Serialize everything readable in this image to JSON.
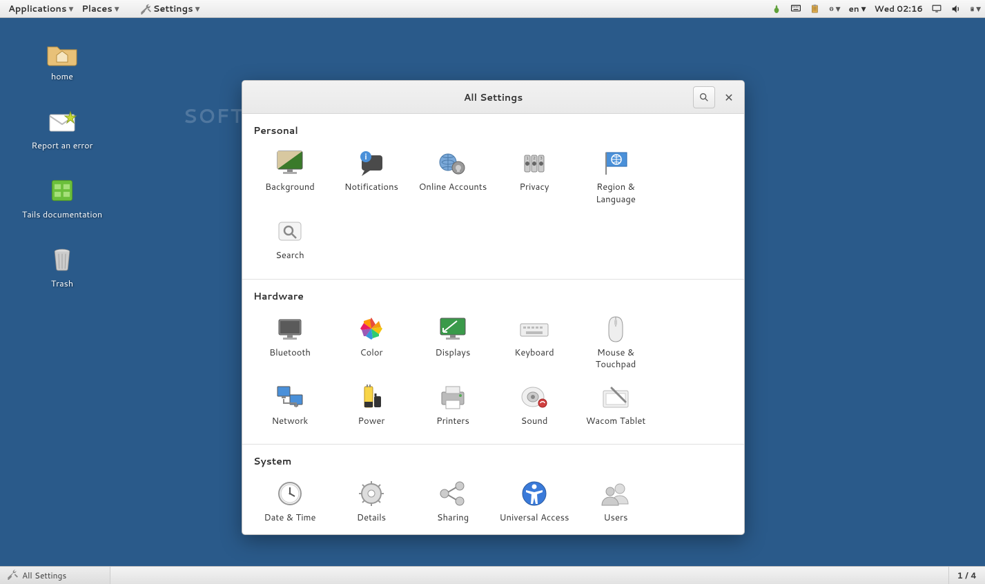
{
  "top_panel": {
    "menus": [
      "Applications",
      "Places",
      "Settings"
    ],
    "lang": "en",
    "clock": "Wed 02:16"
  },
  "desktop_icons": [
    {
      "id": "home",
      "label": "home"
    },
    {
      "id": "report",
      "label": "Report an error"
    },
    {
      "id": "docs",
      "label": "Tails documentation"
    },
    {
      "id": "trash",
      "label": "Trash"
    }
  ],
  "settings_window": {
    "title": "All Settings",
    "sections": [
      {
        "title": "Personal",
        "items": [
          {
            "id": "background",
            "label": "Background"
          },
          {
            "id": "notifications",
            "label": "Notifications"
          },
          {
            "id": "online-accounts",
            "label": "Online Accounts"
          },
          {
            "id": "privacy",
            "label": "Privacy"
          },
          {
            "id": "region",
            "label": "Region & Language"
          },
          {
            "id": "search",
            "label": "Search"
          }
        ]
      },
      {
        "title": "Hardware",
        "items": [
          {
            "id": "bluetooth",
            "label": "Bluetooth"
          },
          {
            "id": "color",
            "label": "Color"
          },
          {
            "id": "displays",
            "label": "Displays"
          },
          {
            "id": "keyboard",
            "label": "Keyboard"
          },
          {
            "id": "mouse",
            "label": "Mouse & Touchpad"
          },
          {
            "id": "network",
            "label": "Network"
          },
          {
            "id": "power",
            "label": "Power"
          },
          {
            "id": "printers",
            "label": "Printers"
          },
          {
            "id": "sound",
            "label": "Sound"
          },
          {
            "id": "wacom",
            "label": "Wacom Tablet"
          }
        ]
      },
      {
        "title": "System",
        "items": [
          {
            "id": "datetime",
            "label": "Date & Time"
          },
          {
            "id": "details",
            "label": "Details"
          },
          {
            "id": "sharing",
            "label": "Sharing"
          },
          {
            "id": "universal",
            "label": "Universal Access"
          },
          {
            "id": "users",
            "label": "Users"
          }
        ]
      }
    ]
  },
  "bottom_panel": {
    "task": "All Settings",
    "workspace": "1 / 4"
  },
  "watermark": "SOFTPEDIA"
}
